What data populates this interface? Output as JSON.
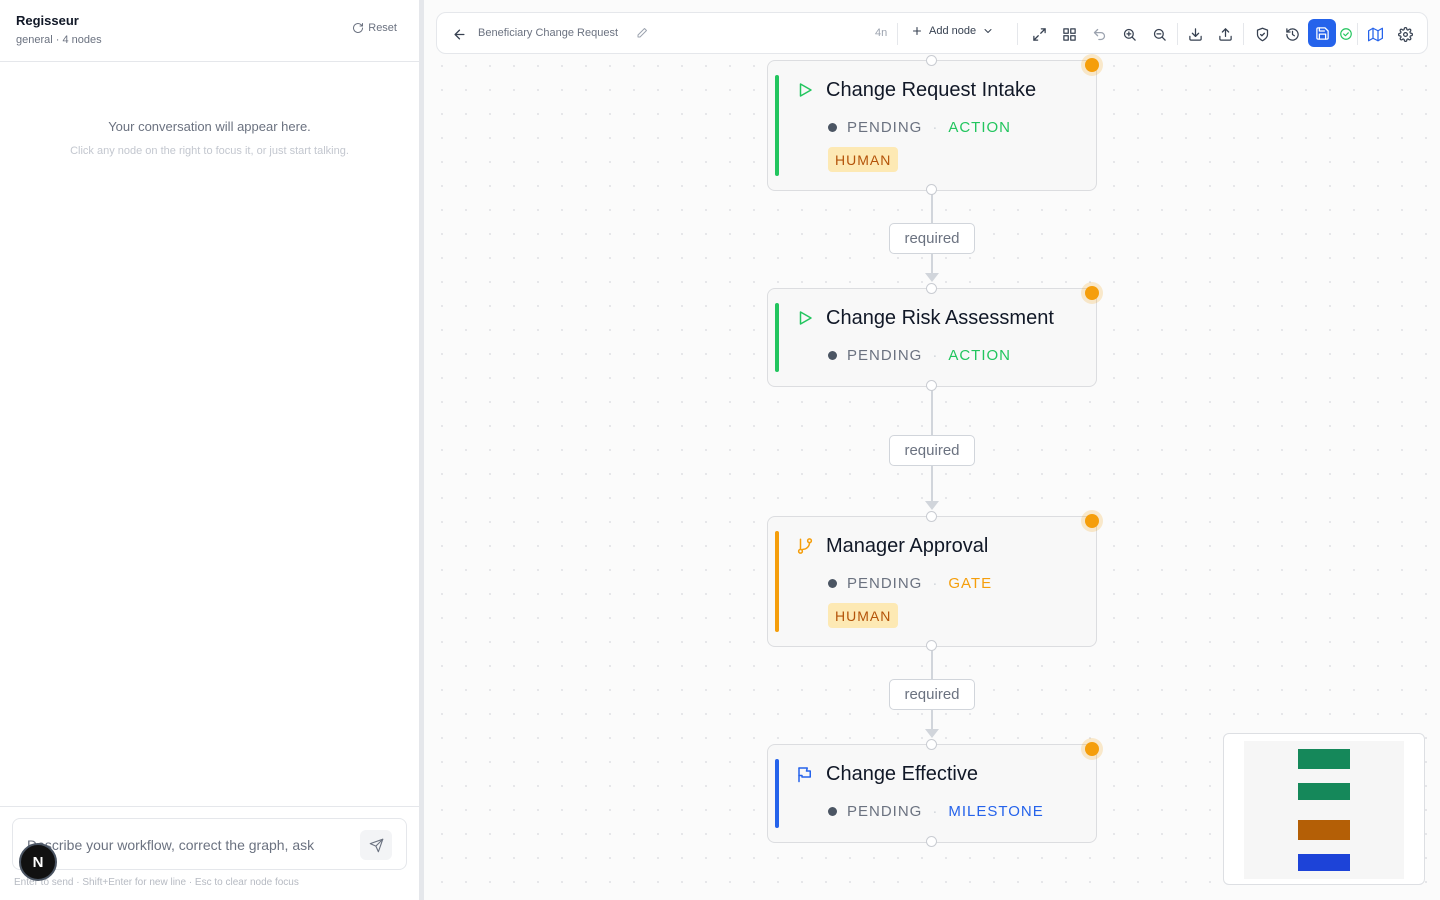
{
  "chat": {
    "app_name": "Regisseur",
    "meta": "general · 4 nodes",
    "reset_label": "Reset",
    "empty_title": "Your conversation will appear here.",
    "empty_subtitle": "Click any node on the right to focus it, or just start talking.",
    "input_placeholder": "Describe your workflow, correct the graph, ask",
    "hint": "Enter to send · Shift+Enter for new line · Esc to clear node focus",
    "avatar_letter": "N"
  },
  "toolbar": {
    "title": "Beneficiary Change Request",
    "node_count": "4n",
    "add_node_label": "Add node",
    "icons": [
      "back-arrow-icon",
      "pencil-icon",
      "plus-icon",
      "chevron-down-icon",
      "expand-icon",
      "layout-icon",
      "undo-icon",
      "zoom-in-icon",
      "zoom-out-icon",
      "download-icon",
      "upload-icon",
      "shield-icon",
      "history-icon",
      "save-icon",
      "check-circle-icon",
      "map-icon",
      "gear-icon"
    ]
  },
  "nodes": [
    {
      "title": "Change Request Intake",
      "status": "PENDING",
      "kind": "ACTION",
      "human": "HUMAN",
      "icon": "play-icon",
      "color": "#22c55e"
    },
    {
      "title": "Change Risk Assessment",
      "status": "PENDING",
      "kind": "ACTION",
      "human": "",
      "icon": "play-icon",
      "color": "#22c55e"
    },
    {
      "title": "Manager Approval",
      "status": "PENDING",
      "kind": "GATE",
      "human": "HUMAN",
      "icon": "branch-icon",
      "color": "#f59e0b"
    },
    {
      "title": "Change Effective",
      "status": "PENDING",
      "kind": "MILESTONE",
      "human": "",
      "icon": "flag-icon",
      "color": "#2563eb"
    }
  ],
  "edges": [
    {
      "label": "required"
    },
    {
      "label": "required"
    },
    {
      "label": "required"
    }
  ],
  "colors": {
    "action": "#22c55e",
    "gate": "#f59e0b",
    "milestone": "#2563eb",
    "human_badge_bg": "#fde9b4",
    "human_badge_text": "#b45309",
    "pending_flag": "#f59e0b",
    "save_button": "#2563eb",
    "minimap_action": "#15885a",
    "minimap_gate": "#b45f06",
    "minimap_milestone": "#1d43d8"
  }
}
